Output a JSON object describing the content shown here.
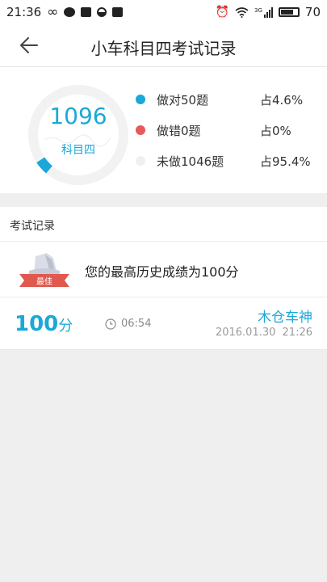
{
  "status_bar": {
    "time": "21:36",
    "battery": "70",
    "net_label": "3G"
  },
  "header": {
    "title": "小车科目四考试记录"
  },
  "summary": {
    "total": "1096",
    "subject": "科目四",
    "correct_fraction": 0.046,
    "stats": [
      {
        "label": "做对50题",
        "percent": "占4.6%",
        "color": "#1ba8d8"
      },
      {
        "label": "做错0题",
        "percent": "占0%",
        "color": "#e85a5a"
      },
      {
        "label": "未做1046题",
        "percent": "占95.4%",
        "color": "#f0f0f0"
      }
    ]
  },
  "records": {
    "section_title": "考试记录",
    "best_badge": "最佳",
    "best_text": "您的最高历史成绩为100分",
    "items": [
      {
        "score": "100",
        "unit": "分",
        "duration": "06:54",
        "rank": "木仓车神",
        "datetime": "2016.01.30 21:26"
      }
    ]
  },
  "colors": {
    "accent": "#1ba8d8",
    "error": "#e85a5a",
    "background": "#efefef"
  }
}
